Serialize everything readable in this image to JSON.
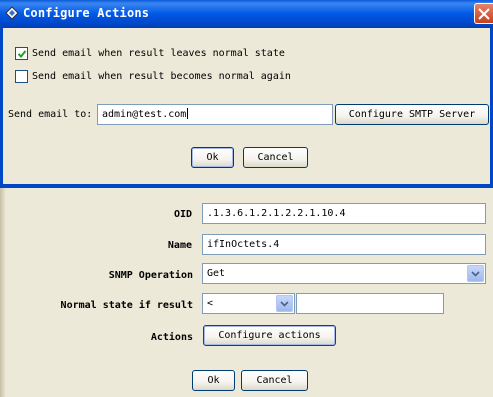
{
  "dialog": {
    "title": "Configure Actions",
    "check_leave": {
      "label": "Send email when result leaves normal state",
      "checked": true
    },
    "check_return": {
      "label": "Send email when result becomes normal again",
      "checked": false
    },
    "email_label": "Send email to:",
    "email_value": "admin@test.com",
    "smtp_button": "Configure SMTP Server",
    "ok_button": "Ok",
    "cancel_button": "Cancel"
  },
  "panel": {
    "oid_label": "OID",
    "oid_value": ".1.3.6.1.2.1.2.2.1.10.4",
    "name_label": "Name",
    "name_value": "ifInOctets.4",
    "snmp_label": "SNMP Operation",
    "snmp_value": "Get",
    "normal_label": "Normal state if result",
    "normal_operator": "<",
    "normal_value": "",
    "actions_label": "Actions",
    "actions_button": "Configure actions",
    "ok_button": "Ok",
    "cancel_button": "Cancel"
  },
  "colors": {
    "titlebar": "#0058e6",
    "close": "#c8401c",
    "face": "#ece9d8",
    "field_border": "#7f9db9"
  }
}
